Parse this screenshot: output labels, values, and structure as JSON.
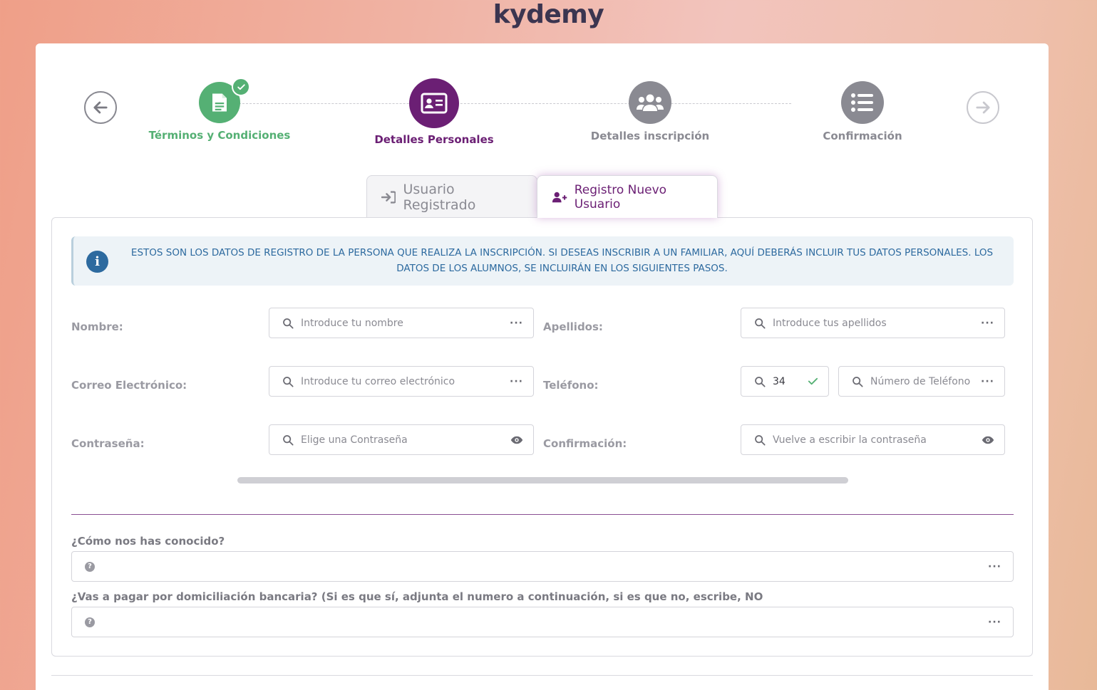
{
  "brand": {
    "name": "kydemy"
  },
  "stepper": {
    "steps": [
      {
        "label": "Términos y Condiciones",
        "state": "done",
        "icon": "document-icon",
        "color": "#55b074"
      },
      {
        "label": "Detalles Personales",
        "state": "active",
        "icon": "id-card-icon",
        "color": "#6b1f74"
      },
      {
        "label": "Detalles inscripción",
        "state": "pending",
        "icon": "users-icon",
        "color": "#8a8a92"
      },
      {
        "label": "Confirmación",
        "state": "pending",
        "icon": "list-icon",
        "color": "#8a8a92"
      }
    ]
  },
  "tabs": {
    "registered_label": "Usuario Registrado",
    "new_label": "Registro Nuevo Usuario"
  },
  "info": {
    "text": "ESTOS SON LOS DATOS DE REGISTRO DE LA PERSONA QUE REALIZA LA INSCRIPCIÓN. SI DESEAS INSCRIBIR A UN FAMILIAR, AQUÍ DEBERÁS INCLUIR TUS DATOS PERSONALES. LOS DATOS DE LOS ALUMNOS, SE INCLUIRÁN EN LOS SIGUIENTES PASOS."
  },
  "form": {
    "name_label": "Nombre:",
    "name_placeholder": "Introduce tu nombre",
    "surname_label": "Apellidos:",
    "surname_placeholder": "Introduce tus apellidos",
    "email_label": "Correo Electrónico:",
    "email_placeholder": "Introduce tu correo electrónico",
    "phone_label": "Teléfono:",
    "phone_prefix": "34",
    "phone_placeholder": "Número de Teléfono",
    "password_label": "Contraseña:",
    "password_placeholder": "Elige una Contraseña",
    "confirm_label": "Confirmación:",
    "confirm_placeholder": "Vuelve a escribir la contraseña"
  },
  "questions": {
    "q1_label": "¿Cómo nos has conocido?",
    "q2_label": "¿Vas a pagar por domiciliación bancaria? (Si es que sí, adjunta el numero a continuación, si es que no, escribe, NO"
  },
  "colors": {
    "accent": "#6b1f74",
    "success": "#55b074",
    "info": "#2d6a9f",
    "muted": "#8a8a92"
  }
}
